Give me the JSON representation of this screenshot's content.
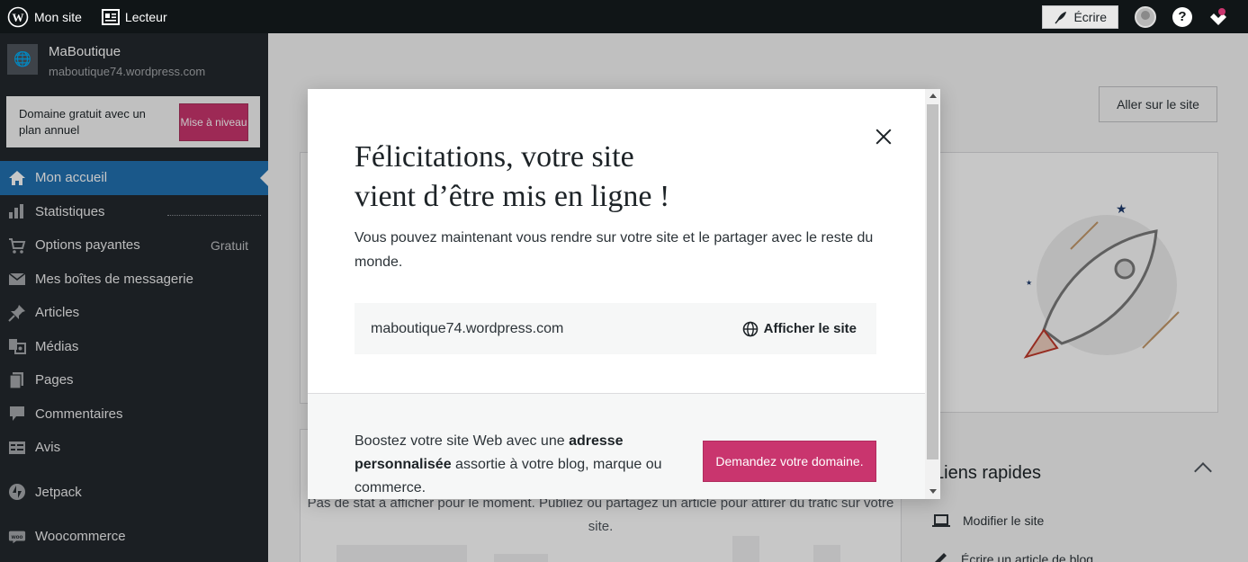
{
  "adminbar": {
    "my_site": "Mon site",
    "reader": "Lecteur",
    "write": "Écrire"
  },
  "sidebar": {
    "site_name": "MaBoutique",
    "site_url": "maboutique74.wordpress.com",
    "upsell_text": "Domaine gratuit avec un plan annuel",
    "upsell_button": "Mise à niveau",
    "items": [
      {
        "label": "Mon accueil",
        "icon": "home-icon"
      },
      {
        "label": "Statistiques",
        "icon": "stats-icon"
      },
      {
        "label": "Options payantes",
        "icon": "cart-icon",
        "badge": "Gratuit"
      },
      {
        "label": "Mes boîtes de messagerie",
        "icon": "mail-icon"
      },
      {
        "label": "Articles",
        "icon": "pin-icon"
      },
      {
        "label": "Médias",
        "icon": "media-icon"
      },
      {
        "label": "Pages",
        "icon": "pages-icon"
      },
      {
        "label": "Commentaires",
        "icon": "comment-icon"
      },
      {
        "label": "Avis",
        "icon": "feedback-icon"
      },
      {
        "label": "Jetpack",
        "icon": "jetpack-icon"
      },
      {
        "label": "Woocommerce",
        "icon": "woo-icon"
      }
    ]
  },
  "main": {
    "visit_site": "Aller sur le site",
    "stats_empty": "Pas de stat à afficher pour le moment. Publiez ou partagez un article pour attirer du trafic sur votre site.",
    "quick_links_title": "Liens rapides",
    "quick_links": [
      "Modifier le site",
      "Écrire un article de blog"
    ]
  },
  "modal": {
    "title_line1": "Félicitations, votre site",
    "title_line2": "vient d’être mis en ligne !",
    "description": "Vous pouvez maintenant vous rendre sur votre site et le partager avec le reste du monde.",
    "site_url": "maboutique74.wordpress.com",
    "view_site": "Afficher le site",
    "footer_pre": "Boostez votre site Web avec une ",
    "footer_bold": "adresse personnalisée",
    "footer_post": " assortie à votre blog, marque ou commerce.",
    "cta": "Demandez votre domaine."
  },
  "colors": {
    "adminbar": "#101517",
    "sidebar": "#23282d",
    "active": "#2271b1",
    "accent": "#c9356e"
  }
}
